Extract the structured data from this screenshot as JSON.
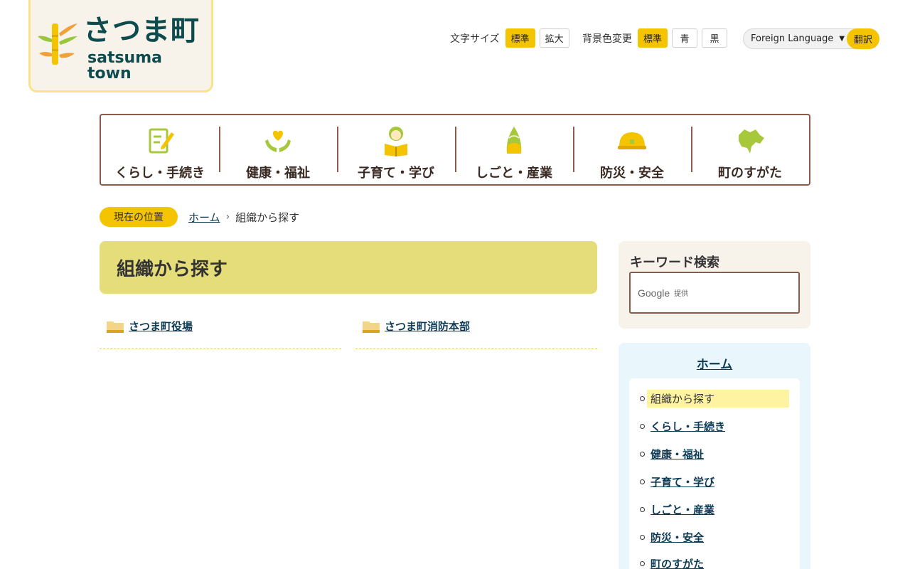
{
  "header": {
    "logo_title": "さつま町",
    "logo_sub": "satsuma town",
    "font_size_label": "文字サイズ",
    "font_size_options": [
      "標準",
      "拡大"
    ],
    "bg_label": "背景色変更",
    "bg_options": [
      "標準",
      "青",
      "黒"
    ],
    "language_select": "Foreign Language",
    "translate_button": "翻訳"
  },
  "gnav": [
    {
      "label": "くらし・手続き",
      "icon": "document-pen-icon"
    },
    {
      "label": "健康・福祉",
      "icon": "heart-hands-icon"
    },
    {
      "label": "子育て・学び",
      "icon": "child-book-icon"
    },
    {
      "label": "しごと・産業",
      "icon": "bamboo-shoot-icon"
    },
    {
      "label": "防災・安全",
      "icon": "helmet-icon"
    },
    {
      "label": "町のすがた",
      "icon": "town-map-icon"
    }
  ],
  "breadcrumb": {
    "label": "現在の位置",
    "home": "ホーム",
    "current": "組織から探す"
  },
  "main": {
    "title": "組織から探す",
    "orgs": [
      "さつま町役場",
      "さつま町消防本部"
    ]
  },
  "sidebar": {
    "search_title": "キーワード検索",
    "search_google": "Google",
    "search_provided": "提供",
    "home": "ホーム",
    "items": [
      "組織から探す",
      "くらし・手続き",
      "健康・福祉",
      "子育て・学び",
      "しごと・産業",
      "防災・安全",
      "町のすがた"
    ]
  },
  "colors": {
    "accent_yellow": "#f5c400",
    "title_band": "#e5dc7a",
    "nav_border": "#8a5a4a",
    "link": "#0d3b55"
  }
}
